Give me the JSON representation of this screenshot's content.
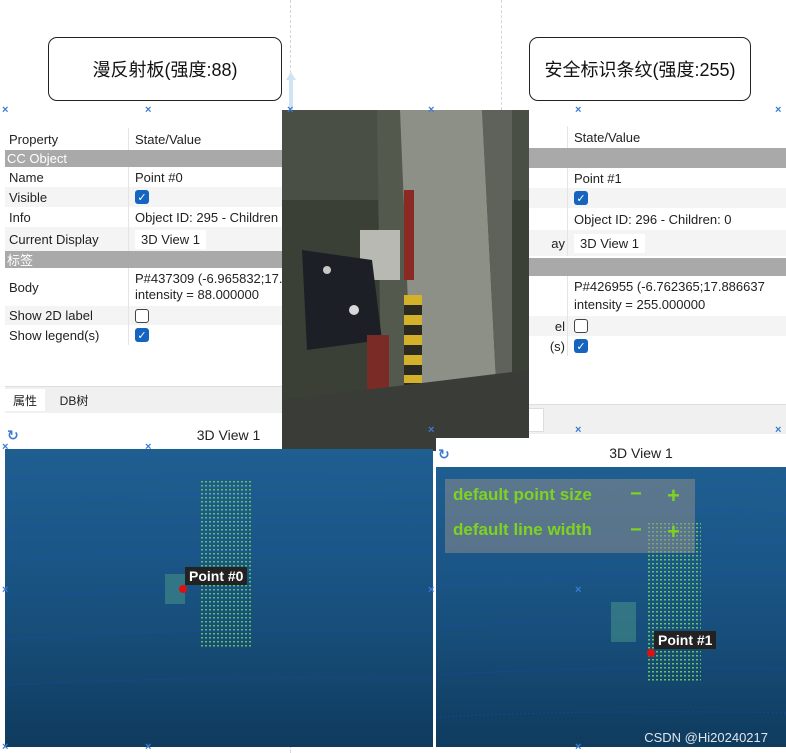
{
  "callouts": {
    "left": "漫反射板(强度:88)",
    "right": "安全标识条纹(强度:255)"
  },
  "left_panel": {
    "header": {
      "property": "Property",
      "value": "State/Value"
    },
    "section_cc": "CC Object",
    "name_label": "Name",
    "name_value": "Point #0",
    "visible_label": "Visible",
    "visible_checked": true,
    "info_label": "Info",
    "info_value": "Object ID: 295 - Children",
    "display_label": "Current Display",
    "display_value": "3D View 1",
    "section_label": "标签",
    "body_label": "Body",
    "body_line1": "P#437309 (-6.965832;17.",
    "body_line2": "intensity = 88.000000",
    "show2d_label": "Show 2D label",
    "show2d_checked": false,
    "legend_label": "Show legend(s)",
    "legend_checked": true,
    "tabs": [
      "属性",
      "DB树"
    ]
  },
  "right_panel": {
    "header": {
      "value": "State/Value"
    },
    "name_value": "Point #1",
    "visible_checked": true,
    "info_value": "Object ID: 296 - Children: 0",
    "display_label_partial": "ay",
    "display_value": "3D View 1",
    "body_line1": "P#426955 (-6.762365;17.886637",
    "body_line2": "intensity = 255.000000",
    "show2d_label_partial": "el",
    "show2d_checked": false,
    "legend_label_partial": "(s)",
    "legend_checked": true
  },
  "left_view": {
    "title": "3D View 1",
    "point_label": "Point #0"
  },
  "right_view": {
    "title": "3D View 1",
    "point_label": "Point #1",
    "overlay": {
      "point_size": "default point size",
      "line_width": "default line width",
      "minus": "−",
      "plus": "+"
    }
  },
  "watermark": "CSDN @Hi20240217",
  "colors": {
    "accent": "#1565c0",
    "section": "#a9a9a9",
    "overlay_text": "#7ed321",
    "cloud_green": "#6fd35a",
    "cloud_blue": "#1d3fe0"
  }
}
